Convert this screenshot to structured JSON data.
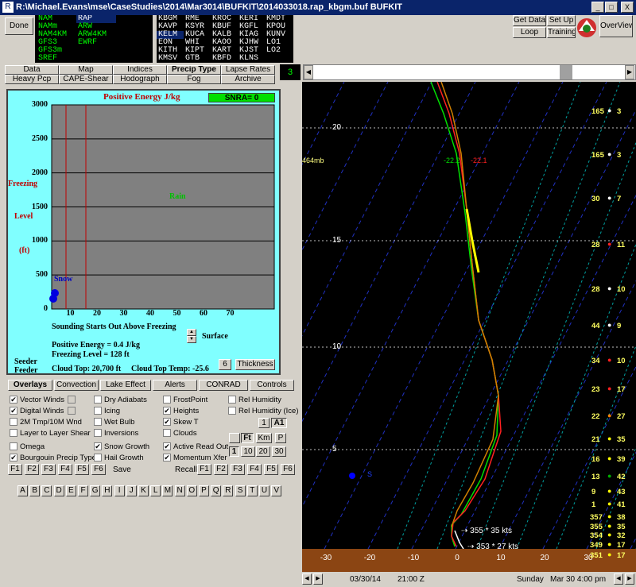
{
  "window": {
    "title": "R:\\Michael.Evans\\mse\\CaseStudies\\2014\\Mar3014\\BUFKIT\\2014033018.rap_kbgm.buf BUFKIT",
    "minimize": "_",
    "maximize": "□",
    "close": "X"
  },
  "toolbar": {
    "done": "Done",
    "get_data": "Get Data",
    "set_up": "Set Up",
    "loop": "Loop",
    "training": "Training",
    "overview": "OverView",
    "model_list": [
      "NAM",
      "NAMm",
      "NAM4KM",
      "GFS3",
      "GFS3m",
      "SREF"
    ],
    "model_list2": [
      "RAP",
      "ARW",
      "ARW4KM",
      "EWRF"
    ],
    "stations": [
      [
        "KBGM",
        "RME",
        "KROC",
        "KERI",
        "KMDT"
      ],
      [
        "KAVP",
        "KSYR",
        "KBUF",
        "KGFL",
        "KPOU"
      ],
      [
        "KELM",
        "KUCA",
        "KALB",
        "KIAG",
        "KUNV"
      ],
      [
        "EON",
        "WHI",
        "KAOO",
        "KJHW",
        "LO1"
      ],
      [
        "KITH",
        "KIPT",
        "KART",
        "KJST",
        "LO2"
      ],
      [
        "KMSV",
        "GTB",
        "KBFD",
        "KLNS",
        ""
      ]
    ]
  },
  "tabs": {
    "row1": [
      "Data",
      "Map",
      "Indices",
      "Precip Type",
      "Lapse Rates"
    ],
    "row2": [
      "Heavy Pcp",
      "CAPE-Shear",
      "Hodograph",
      "Fog",
      "Archive"
    ],
    "counter": "3"
  },
  "precip_panel": {
    "title": "Positive Energy J/kg",
    "snra": "SNRA= 0",
    "y_label": [
      "Freezing",
      "Level",
      "(ft)"
    ],
    "y_ticks": [
      "3000",
      "2500",
      "2000",
      "1500",
      "1000",
      "500",
      "0"
    ],
    "x_ticks": [
      "10",
      "20",
      "30",
      "40",
      "50",
      "60",
      "70"
    ],
    "rain_label": "Rain",
    "snow_label": "Snow",
    "starts_above": "Sounding Starts Out Above Freezing",
    "positive_energy": "Positive Energy = 0.4 J/kg",
    "freezing_level": "Freezing Level = 128 ft",
    "surface": "Surface",
    "seeder": "Seeder",
    "feeder": "Feeder",
    "cloud_top": "Cloud Top: 20,700 ft",
    "cloud_top_temp": "Cloud Top Temp: -25.6",
    "six_btn": "6",
    "thickness_btn": "Thickness"
  },
  "overlay_tabs": [
    "Overlays",
    "Convection",
    "Lake Effect",
    "Alerts",
    "CONRAD",
    "Controls"
  ],
  "overlays": {
    "col1": [
      {
        "label": "Vector Winds",
        "checked": true
      },
      {
        "label": "Digital Winds",
        "checked": true
      },
      {
        "label": "2M Tmp/10M Wnd",
        "checked": false
      },
      {
        "label": "Layer to Layer Shear",
        "checked": false
      },
      {
        "label": "Omega",
        "checked": false
      },
      {
        "label": "Bourgouin Precip Type",
        "checked": true
      }
    ],
    "col2": [
      {
        "label": "Dry Adiabats",
        "checked": false
      },
      {
        "label": "Icing",
        "checked": false
      },
      {
        "label": "Wet Bulb",
        "checked": false
      },
      {
        "label": "Inversions",
        "checked": false
      },
      {
        "label": "Snow Growth",
        "checked": true
      },
      {
        "label": "Hail Growth",
        "checked": false
      }
    ],
    "col3": [
      {
        "label": "FrostPoint",
        "checked": false
      },
      {
        "label": "Heights",
        "checked": true
      },
      {
        "label": "Skew T",
        "checked": true
      },
      {
        "label": "Clouds",
        "checked": false
      },
      {
        "label": "Active Read Out",
        "checked": true
      },
      {
        "label": "Momentum Xfer",
        "checked": true
      }
    ],
    "col4": [
      {
        "label": "Rel Humidity",
        "checked": false
      },
      {
        "label": "Rel Humidity (Ice)",
        "checked": false
      }
    ],
    "btn_1": "1",
    "btn_a1": "A1",
    "btn_ft": "Ft",
    "btn_km": "Km",
    "btn_p": "P",
    "nums": [
      "1",
      "10",
      "20",
      "30"
    ]
  },
  "fkeys": {
    "left": [
      "F1",
      "F2",
      "F3",
      "F4",
      "F5",
      "F6"
    ],
    "save": "Save",
    "recall": "Recall",
    "right": [
      "F1",
      "F2",
      "F3",
      "F4",
      "F5",
      "F6"
    ]
  },
  "letters": [
    "A",
    "B",
    "C",
    "D",
    "E",
    "F",
    "G",
    "H",
    "I",
    "J",
    "K",
    "L",
    "M",
    "N",
    "O",
    "P",
    "Q",
    "R",
    "S",
    "T",
    "U",
    "V"
  ],
  "sounding": {
    "mb_label": "464mb",
    "readout": "-22.2",
    "readout2": "-22.1",
    "height_ticks": [
      "20",
      "15",
      "10",
      "5"
    ],
    "temp_ticks": [
      "-30",
      "-20",
      "-10",
      "0",
      "10",
      "20",
      "30"
    ],
    "wind1": "355 * 35 kts",
    "wind2": "353 * 27 kts",
    "s_marker": "S",
    "digital_winds": [
      {
        "dir": "165",
        "spd": "3"
      },
      {
        "dir": "165",
        "spd": "3"
      },
      {
        "dir": "30",
        "spd": "7"
      },
      {
        "dir": "28",
        "spd": "11"
      },
      {
        "dir": "28",
        "spd": "10"
      },
      {
        "dir": "44",
        "spd": "9"
      },
      {
        "dir": "34",
        "spd": "10"
      },
      {
        "dir": "23",
        "spd": "17"
      },
      {
        "dir": "22",
        "spd": "27"
      },
      {
        "dir": "21",
        "spd": "35"
      },
      {
        "dir": "16",
        "spd": "39"
      },
      {
        "dir": "13",
        "spd": "42"
      },
      {
        "dir": "9",
        "spd": "43"
      },
      {
        "dir": "1",
        "spd": "41"
      },
      {
        "dir": "357",
        "spd": "38"
      },
      {
        "dir": "355",
        "spd": "35"
      },
      {
        "dir": "354",
        "spd": "32"
      },
      {
        "dir": "349",
        "spd": "17"
      },
      {
        "dir": "351",
        "spd": "17"
      }
    ],
    "wind_colors": [
      "#ffffff",
      "#ffffff",
      "#ffffff",
      "#ff2020",
      "#ffffff",
      "#ffffff",
      "#ff2020",
      "#ff2020",
      "#ff8000",
      "#ffff00",
      "#ffff00",
      "#00b000",
      "#ffff00",
      "#ffff00",
      "#ffff00",
      "#ffff00",
      "#ffff00",
      "#ffff00",
      "#ffff00"
    ]
  },
  "statusbar": {
    "date": "03/30/14",
    "time": "21:00 Z",
    "weekday": "Sunday",
    "local": "Mar 30  4:00 pm"
  }
}
